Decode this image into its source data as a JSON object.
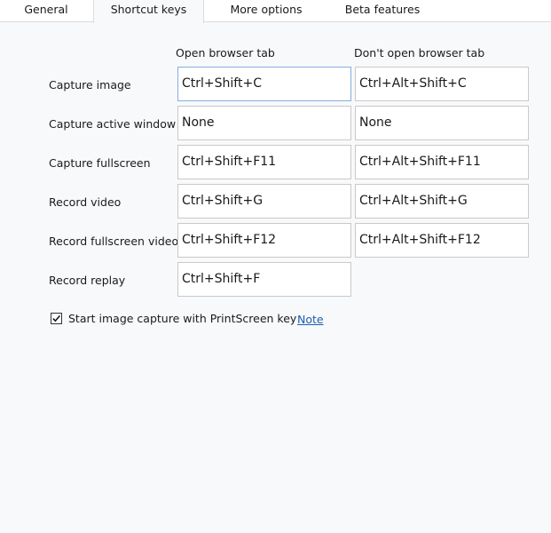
{
  "tabs": [
    {
      "label": "General"
    },
    {
      "label": "Shortcut keys"
    },
    {
      "label": "More options"
    },
    {
      "label": "Beta features"
    }
  ],
  "active_tab": "Shortcut keys",
  "columns": {
    "open_tab": "Open browser tab",
    "no_tab": "Don't open browser tab"
  },
  "rows": [
    {
      "label": "Capture image",
      "open_tab": "Ctrl+Shift+C",
      "no_tab": "Ctrl+Alt+Shift+C"
    },
    {
      "label": "Capture active window",
      "open_tab": "None",
      "no_tab": "None"
    },
    {
      "label": "Capture fullscreen",
      "open_tab": "Ctrl+Shift+F11",
      "no_tab": "Ctrl+Alt+Shift+F11"
    },
    {
      "label": "Record video",
      "open_tab": "Ctrl+Shift+G",
      "no_tab": "Ctrl+Alt+Shift+G"
    },
    {
      "label": "Record fullscreen video",
      "open_tab": "Ctrl+Shift+F12",
      "no_tab": "Ctrl+Alt+Shift+F12"
    },
    {
      "label": "Record replay",
      "open_tab": "Ctrl+Shift+F"
    }
  ],
  "printscreen": {
    "label": "Start image capture with PrintScreen key",
    "checked": true,
    "note_link": "Note"
  }
}
